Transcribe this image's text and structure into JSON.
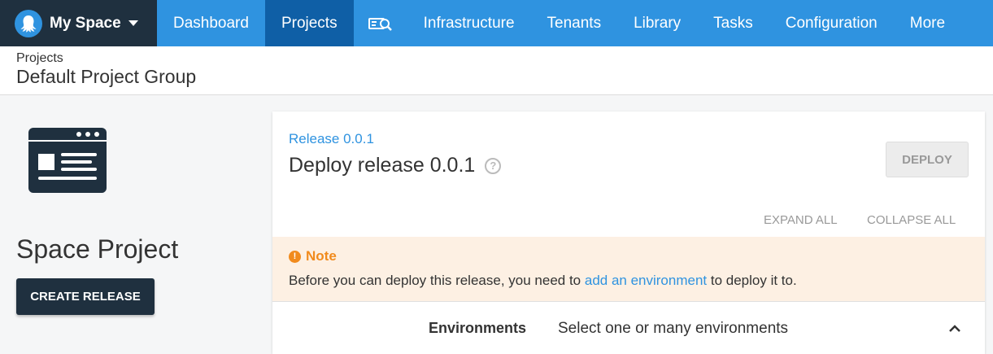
{
  "nav": {
    "space_name": "My Space",
    "items": [
      {
        "label": "Dashboard",
        "active": false
      },
      {
        "label": "Projects",
        "active": true
      },
      {
        "label": "Infrastructure",
        "active": false
      },
      {
        "label": "Tenants",
        "active": false
      },
      {
        "label": "Library",
        "active": false
      },
      {
        "label": "Tasks",
        "active": false
      },
      {
        "label": "Configuration",
        "active": false
      },
      {
        "label": "More",
        "active": false
      }
    ],
    "search_icon": "search-icon",
    "colors": {
      "bar": "#2f93e0",
      "active": "#0f5fa6",
      "space": "#1f303f"
    }
  },
  "header": {
    "breadcrumb": "Projects",
    "title": "Default Project Group"
  },
  "project": {
    "name": "Space Project",
    "create_release_label": "CREATE RELEASE",
    "logo_icon": "browser-window-icon"
  },
  "deploy": {
    "release_link": "Release 0.0.1",
    "title": "Deploy release 0.0.1",
    "deploy_label": "DEPLOY",
    "expand_all": "EXPAND ALL",
    "collapse_all": "COLLAPSE ALL"
  },
  "note": {
    "title": "Note",
    "text_before": "Before you can deploy this release, you need to ",
    "link": "add an environment",
    "text_after": " to deploy it to.",
    "color": "#f18b1d",
    "background": "#fdf0e3"
  },
  "environments": {
    "label": "Environments",
    "value": "Select one or many environments"
  }
}
